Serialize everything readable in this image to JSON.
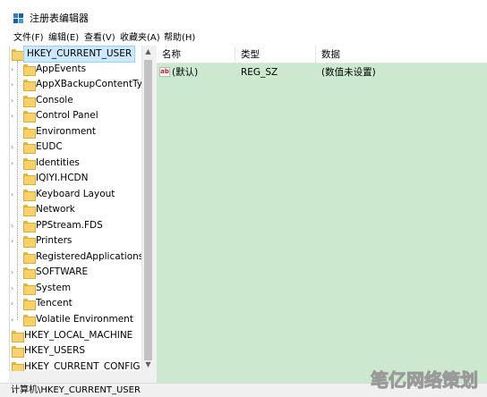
{
  "window": {
    "title": "注册表编辑器",
    "icon": "registry-editor-icon"
  },
  "menu": [
    "文件(F)",
    "编辑(E)",
    "查看(V)",
    "收藏夹(A)",
    "帮助(H)"
  ],
  "tree": {
    "root": "HKEY_CURRENT_USER",
    "children": [
      "AppEvents",
      "AppXBackupContentType",
      "Console",
      "Control Panel",
      "Environment",
      "EUDC",
      "Identities",
      "IQIYI.HCDN",
      "Keyboard Layout",
      "Network",
      "PPStream.FDS",
      "Printers",
      "RegisteredApplications",
      "SOFTWARE",
      "System",
      "Tencent",
      "Volatile Environment"
    ],
    "siblings": [
      "HKEY_LOCAL_MACHINE",
      "HKEY_USERS",
      "HKEY_CURRENT_CONFIG"
    ]
  },
  "list": {
    "columns": [
      "名称",
      "类型",
      "数据"
    ],
    "rows": [
      {
        "name": "(默认)",
        "type": "REG_SZ",
        "data": "(数值未设置)",
        "icon": "ab"
      }
    ]
  },
  "status": "计算机\\HKEY_CURRENT_USER",
  "watermark": "笔亿网络策划",
  "colors": {
    "list_bg": "#cce9cf",
    "selection": "#cce8ff",
    "folder": "#f7d26b"
  }
}
